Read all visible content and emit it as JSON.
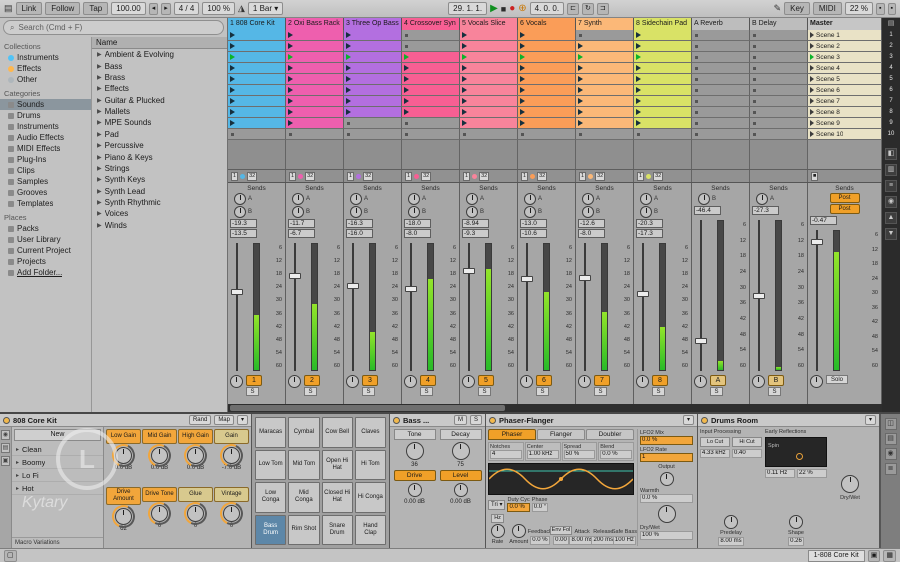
{
  "watermark": {
    "letter": "L",
    "caption": "Kytary"
  },
  "toolbar": {
    "link": "Link",
    "follow": "Follow",
    "tap": "Tap",
    "tempo": "100.00",
    "sig_num": "4",
    "sig_den": "4",
    "groove": "100 %",
    "quantize": "1 Bar",
    "position": "29. 1. 1.",
    "loop_length": "4. 0. 0.",
    "key": "Key",
    "midi": "MIDI",
    "cpu": "22 %"
  },
  "browser": {
    "search_placeholder": "Search (Cmd + F)",
    "sections": [
      {
        "label": "Collections",
        "items": [
          {
            "label": "Instruments",
            "dot": "#4fc3f7"
          },
          {
            "label": "Effects",
            "dot": "#ffb74d"
          },
          {
            "label": "Other",
            "dot": "#aeb6bb"
          }
        ]
      },
      {
        "label": "Categories",
        "items": [
          {
            "label": "Sounds",
            "selected": true
          },
          {
            "label": "Drums"
          },
          {
            "label": "Instruments"
          },
          {
            "label": "Audio Effects"
          },
          {
            "label": "MIDI Effects"
          },
          {
            "label": "Plug-Ins"
          },
          {
            "label": "Clips"
          },
          {
            "label": "Samples"
          },
          {
            "label": "Grooves"
          },
          {
            "label": "Templates"
          }
        ]
      },
      {
        "label": "Places",
        "items": [
          {
            "label": "Packs"
          },
          {
            "label": "User Library"
          },
          {
            "label": "Current Project"
          },
          {
            "label": "Projects"
          },
          {
            "label": "Add Folder...",
            "underline": true
          }
        ]
      }
    ],
    "list_header": "Name",
    "list_items": [
      "Ambient & Evolving",
      "Bass",
      "Brass",
      "Effects",
      "Guitar & Plucked",
      "Mallets",
      "MPE Sounds",
      "Pad",
      "Percussive",
      "Piano & Keys",
      "Strings",
      "Synth Keys",
      "Synth Lead",
      "Synth Rhythmic",
      "Voices",
      "Winds"
    ]
  },
  "session": {
    "tracks": [
      {
        "name": "1 808 Core Kit",
        "color": "#55b7e6",
        "clips": [
          1,
          1,
          1,
          1,
          1,
          1,
          1,
          1,
          1,
          0
        ]
      },
      {
        "name": "2 Oxi Bass Rack",
        "color": "#ee5fae",
        "clips": [
          1,
          1,
          1,
          1,
          1,
          1,
          1,
          1,
          1,
          0
        ]
      },
      {
        "name": "3 Three Op Bass",
        "color": "#b36fe0",
        "clips": [
          1,
          1,
          1,
          1,
          1,
          1,
          1,
          1,
          0,
          0
        ]
      },
      {
        "name": "4 Crossover Syn",
        "color": "#f75f93",
        "clips": [
          0,
          0,
          1,
          1,
          1,
          1,
          1,
          1,
          0,
          0
        ]
      },
      {
        "name": "5 Vocals Slice",
        "color": "#f8849b",
        "clips": [
          1,
          1,
          1,
          1,
          1,
          1,
          1,
          1,
          1,
          0
        ]
      },
      {
        "name": "6 Vocals",
        "color": "#fa9d58",
        "clips": [
          1,
          1,
          1,
          1,
          1,
          1,
          1,
          1,
          1,
          0
        ]
      },
      {
        "name": "7 Synth",
        "color": "#fbb878",
        "clips": [
          0,
          1,
          1,
          1,
          1,
          1,
          1,
          1,
          1,
          0
        ]
      },
      {
        "name": "8 Sidechain Pad",
        "color": "#d9e266",
        "clips": [
          1,
          1,
          1,
          1,
          1,
          1,
          1,
          1,
          1,
          0
        ]
      }
    ],
    "returns": [
      {
        "name": "A Reverb"
      },
      {
        "name": "B Delay"
      }
    ],
    "master_name": "Master",
    "scenes": [
      "Scene 1",
      "Scene 2",
      "Scene 3",
      "Scene 4",
      "Scene 5",
      "Scene 6",
      "Scene 7",
      "Scene 8",
      "Scene 9",
      "Scene 10"
    ],
    "playing_scene": 2,
    "slot_status": {
      "left": "1",
      "right": "32"
    }
  },
  "mixer": {
    "sends_label": "Sends",
    "send_letters": [
      "A",
      "B"
    ],
    "solo_label": "S",
    "scale": [
      "6",
      "12",
      "18",
      "24",
      "30",
      "36",
      "42",
      "48",
      "54",
      "60"
    ],
    "channels": [
      {
        "num": "1",
        "vol": "-19.3",
        "peak": "-13.5",
        "meter": 0.44
      },
      {
        "num": "2",
        "vol": "-11.7",
        "peak": "-6.7",
        "meter": 0.52
      },
      {
        "num": "3",
        "vol": "-16.3",
        "peak": "-16.0",
        "meter": 0.3
      },
      {
        "num": "4",
        "vol": "-18.0",
        "peak": "-8.0",
        "meter": 0.72
      },
      {
        "num": "5",
        "vol": "-8.94",
        "peak": "-9.3",
        "meter": 0.8
      },
      {
        "num": "6",
        "vol": "-13.0",
        "peak": "-10.6",
        "meter": 0.62
      },
      {
        "num": "7",
        "vol": "-12.6",
        "peak": "-8.0",
        "meter": 0.46
      },
      {
        "num": "8",
        "vol": "-20.3",
        "peak": "-17.3",
        "meter": 0.34
      },
      {
        "num": "A",
        "vol": "-46.4",
        "peak": "",
        "meter": 0.06,
        "is_return": true
      },
      {
        "num": "B",
        "vol": "-27.3",
        "peak": "",
        "meter": 0.02,
        "is_return": true
      }
    ],
    "master": {
      "sends_label": "Sends",
      "post_a": "Post",
      "post_b": "Post",
      "vol": "-0.47",
      "meter": 0.85,
      "solo_label": "Solo"
    }
  },
  "devices": {
    "rack": {
      "title": "808 Core Kit",
      "rand_label": "Rand",
      "map_label": "Map",
      "new_label": "New",
      "chains": [
        "Clean",
        "Boomy",
        "Lo Fi",
        "Hot"
      ],
      "footer_label": "Macro Variations",
      "macros": [
        {
          "label": "Low Gain",
          "value": "0.0 dB",
          "color": "#f2a63b"
        },
        {
          "label": "Mid Gain",
          "value": "0.0 dB",
          "color": "#f2a63b"
        },
        {
          "label": "High Gain",
          "value": "0.0 dB",
          "color": "#f2a63b"
        },
        {
          "label": "Gain",
          "value": "-7.0 dB",
          "color": "#d8c98e"
        },
        {
          "label": "Drive Amount",
          "value": "62",
          "color": "#f2a63b"
        },
        {
          "label": "Drive Tone",
          "value": "0",
          "color": "#f2a63b"
        },
        {
          "label": "Glue",
          "value": "0",
          "color": "#d8c98e"
        },
        {
          "label": "Vintage",
          "value": "0",
          "color": "#d8c98e"
        }
      ]
    },
    "pads": {
      "cells": [
        "Maracas",
        "Cymbal",
        "Cow Bell",
        "Claves",
        "Low Tom",
        "Mid Tom",
        "Open Hi Hat",
        "Hi Tom",
        "Low Conga",
        "Mid Conga",
        "Closed Hi Hat",
        "Hi Conga",
        "Bass Drum",
        "Rim Shot",
        "Snare Drum",
        "Hand Clap"
      ],
      "selected": "Bass Drum"
    },
    "bass": {
      "title": "Bass ...",
      "mute_label": "M",
      "solo_label": "S",
      "tone_label": "Tone",
      "tone_value": "36",
      "decay_label": "Decay",
      "decay_value": "75",
      "drive_label": "Drive",
      "level_label": "Level",
      "drive_out": "0.00 dB",
      "level_out": "0.00 dB"
    },
    "phaser": {
      "title": "Phaser-Flanger",
      "tabs": [
        "Phaser",
        "Flanger",
        "Doubler"
      ],
      "params": [
        {
          "label": "Notches",
          "value": "4"
        },
        {
          "label": "Center",
          "value": "1.00 kHz"
        },
        {
          "label": "Spread",
          "value": "50 %"
        },
        {
          "label": "Blend",
          "value": "0.0 %"
        }
      ],
      "wave_type": "Tri",
      "duty_label": "Duty Cyc",
      "duty_value": "0.0 %",
      "phase_label": "Phase",
      "phase_value": "0.0 °",
      "lfo2mix_label": "LFO2 Mix",
      "lfo2mix_value": "0.0 %",
      "lfo2rate_label": "LFO2 Rate",
      "lfo2rate_value": "1",
      "hz_label": "Hz",
      "rate_label": "Rate",
      "amount_label": "Amount",
      "feedback_label": "Feedback",
      "feedback_value": "0.0 %",
      "envfol_label": "Env Fol",
      "envfol_value": "0.00",
      "attack_label": "Attack",
      "attack_value": "8.00 ms",
      "release_label": "Release",
      "release_value": "200 ms",
      "safebass_label": "Safe Bass",
      "safebass_value": "100 Hz",
      "output_label": "Output",
      "warmth_label": "Warmth",
      "warmth_value": "0.0 %",
      "drywet_label": "Dry/Wet",
      "drywet_value": "100 %"
    },
    "room": {
      "title": "Drums Room",
      "input_label": "Input Processing",
      "locut_label": "Lo Cut",
      "hicut_label": "Hi Cut",
      "early_label": "Early Reflections",
      "spin_label": "Spin",
      "freq_value": "4.33 kHz",
      "reso_value": "0.40",
      "spin_rate": "0.11 Hz",
      "spin_amount": "22 %",
      "predelay_label": "Predelay",
      "predelay_value": "8.00 ms",
      "shape_label": "Shape",
      "shape_value": "0.26",
      "drywet_label": "Dry/Wet"
    }
  },
  "status_bar": {
    "clip_label": "1-808 Core Kit"
  }
}
